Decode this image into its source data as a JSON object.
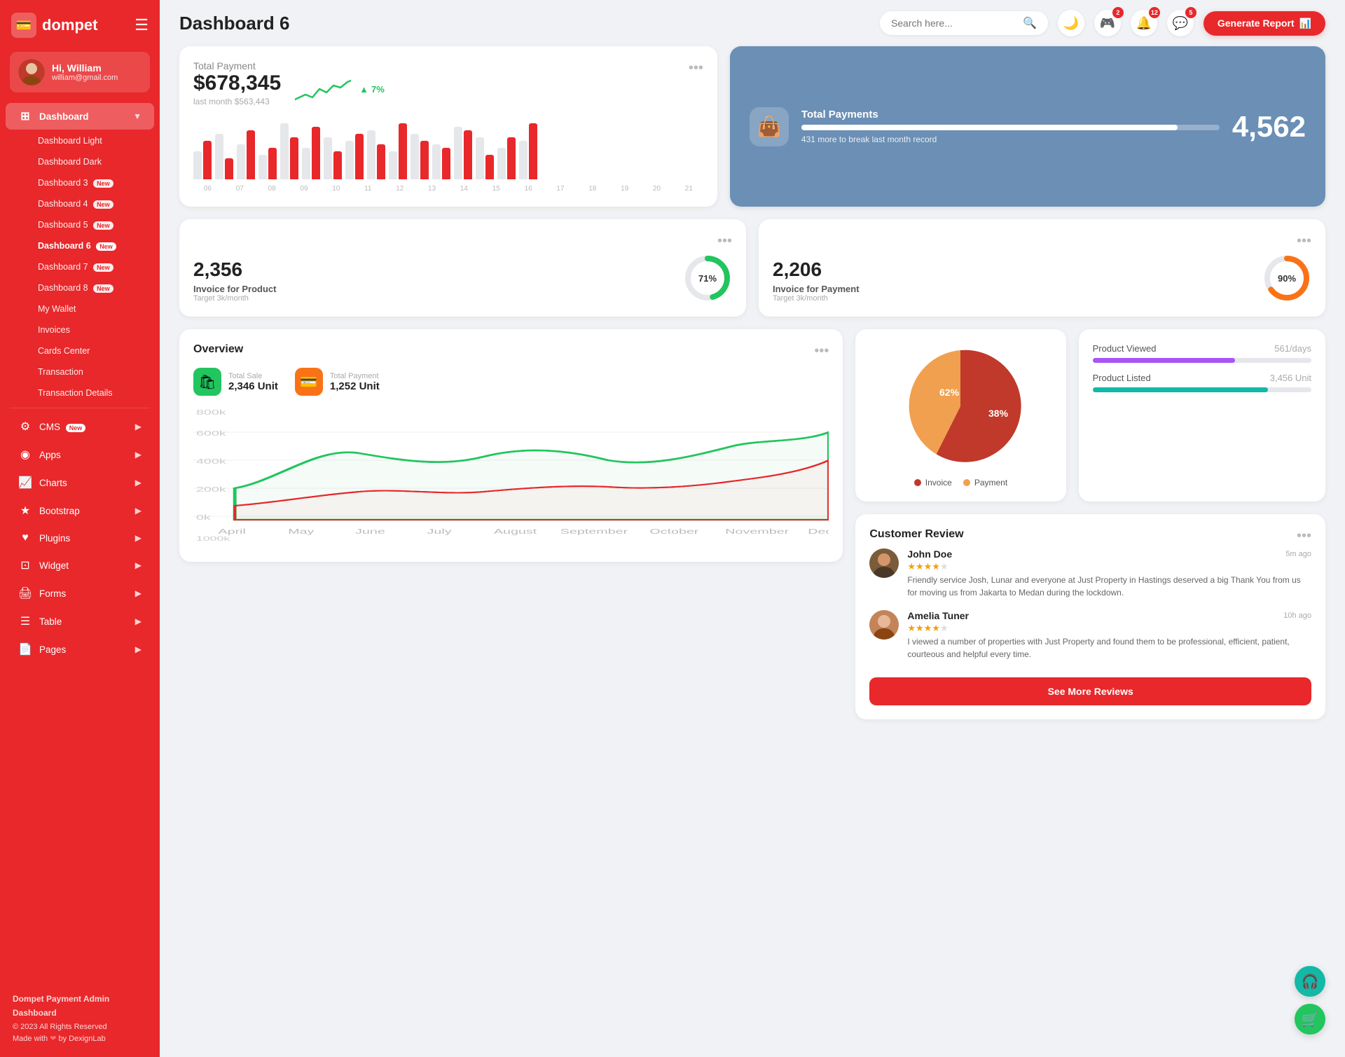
{
  "app": {
    "name": "dompet",
    "logo_icon": "💳"
  },
  "sidebar": {
    "user": {
      "name": "Hi, William",
      "email": "william@gmail.com"
    },
    "nav": [
      {
        "id": "dashboard",
        "label": "Dashboard",
        "icon": "⊞",
        "hasArrow": true,
        "active": true
      },
      {
        "id": "cms",
        "label": "CMS",
        "icon": "⚙",
        "hasArrow": true,
        "badge": "New"
      },
      {
        "id": "apps",
        "label": "Apps",
        "icon": "◉",
        "hasArrow": true
      },
      {
        "id": "charts",
        "label": "Charts",
        "icon": "📈",
        "hasArrow": true
      },
      {
        "id": "bootstrap",
        "label": "Bootstrap",
        "icon": "★",
        "hasArrow": true
      },
      {
        "id": "plugins",
        "label": "Plugins",
        "icon": "♥",
        "hasArrow": true
      },
      {
        "id": "widget",
        "label": "Widget",
        "icon": "⊡",
        "hasArrow": true
      },
      {
        "id": "forms",
        "label": "Forms",
        "icon": "🖨",
        "hasArrow": true
      },
      {
        "id": "table",
        "label": "Table",
        "icon": "☰",
        "hasArrow": true
      },
      {
        "id": "pages",
        "label": "Pages",
        "icon": "📄",
        "hasArrow": true
      }
    ],
    "sub_items": [
      {
        "id": "dashboard-light",
        "label": "Dashboard Light"
      },
      {
        "id": "dashboard-dark",
        "label": "Dashboard Dark"
      },
      {
        "id": "dashboard-3",
        "label": "Dashboard 3",
        "badge": "New"
      },
      {
        "id": "dashboard-4",
        "label": "Dashboard 4",
        "badge": "New"
      },
      {
        "id": "dashboard-5",
        "label": "Dashboard 5",
        "badge": "New"
      },
      {
        "id": "dashboard-6",
        "label": "Dashboard 6",
        "badge": "New",
        "active": true
      },
      {
        "id": "dashboard-7",
        "label": "Dashboard 7",
        "badge": "New"
      },
      {
        "id": "dashboard-8",
        "label": "Dashboard 8",
        "badge": "New"
      },
      {
        "id": "my-wallet",
        "label": "My Wallet"
      },
      {
        "id": "invoices",
        "label": "Invoices"
      },
      {
        "id": "cards-center",
        "label": "Cards Center"
      },
      {
        "id": "transaction",
        "label": "Transaction"
      },
      {
        "id": "transaction-details",
        "label": "Transaction Details"
      }
    ],
    "footer": {
      "title": "Dompet Payment Admin Dashboard",
      "copyright": "© 2023 All Rights Reserved",
      "made_by": "Made with ❤ by DexignLab"
    }
  },
  "topbar": {
    "title": "Dashboard 6",
    "search_placeholder": "Search here...",
    "badges": {
      "games": 2,
      "bell": 12,
      "chat": 5
    },
    "generate_btn": "Generate Report"
  },
  "total_payment": {
    "title": "Total Payment",
    "amount": "$678,345",
    "last_month_label": "last month $563,443",
    "trend_pct": "7%",
    "bars": [
      {
        "gray": 40,
        "red": 55
      },
      {
        "gray": 65,
        "red": 30
      },
      {
        "gray": 50,
        "red": 70
      },
      {
        "gray": 35,
        "red": 45
      },
      {
        "gray": 80,
        "red": 60
      },
      {
        "gray": 45,
        "red": 75
      },
      {
        "gray": 60,
        "red": 40
      },
      {
        "gray": 55,
        "red": 65
      },
      {
        "gray": 70,
        "red": 50
      },
      {
        "gray": 40,
        "red": 80
      },
      {
        "gray": 65,
        "red": 55
      },
      {
        "gray": 50,
        "red": 45
      },
      {
        "gray": 75,
        "red": 70
      },
      {
        "gray": 60,
        "red": 35
      },
      {
        "gray": 45,
        "red": 60
      }
    ],
    "labels": [
      "06",
      "07",
      "08",
      "09",
      "10",
      "11",
      "12",
      "13",
      "14",
      "15",
      "16",
      "17",
      "18",
      "19",
      "20",
      "21"
    ]
  },
  "total_payments_banner": {
    "title": "Total Payments",
    "sub": "431 more to break last month record",
    "count": "4,562",
    "bar_pct": 90
  },
  "invoice_product": {
    "title": "Invoice for Product",
    "amount": "2,356",
    "sub": "Target 3k/month",
    "percent": 71,
    "color": "#22c55e"
  },
  "invoice_payment": {
    "title": "Invoice for Payment",
    "amount": "2,206",
    "sub": "Target 3k/month",
    "percent": 90,
    "color": "#f97316"
  },
  "overview": {
    "title": "Overview",
    "total_sale": {
      "label": "Total Sale",
      "value": "2,346 Unit"
    },
    "total_payment": {
      "label": "Total Payment",
      "value": "1,252 Unit"
    },
    "months": [
      "April",
      "May",
      "June",
      "July",
      "August",
      "September",
      "October",
      "November",
      "Dec."
    ]
  },
  "pie_chart": {
    "invoice_pct": 62,
    "payment_pct": 38,
    "invoice_color": "#c0392b",
    "payment_color": "#f0a04e",
    "legend_invoice": "Invoice",
    "legend_payment": "Payment"
  },
  "product_stats": {
    "viewed": {
      "label": "Product Viewed",
      "value": "561/days",
      "color": "#a855f7",
      "pct": 65
    },
    "listed": {
      "label": "Product Listed",
      "value": "3,456 Unit",
      "color": "#14b8a6",
      "pct": 80
    }
  },
  "customer_review": {
    "title": "Customer Review",
    "reviews": [
      {
        "name": "John Doe",
        "time": "5m ago",
        "stars": 4,
        "text": "Friendly service Josh, Lunar and everyone at Just Property in Hastings deserved a big Thank You from us for moving us from Jakarta to Medan during the lockdown."
      },
      {
        "name": "Amelia Tuner",
        "time": "10h ago",
        "stars": 4,
        "text": "I viewed a number of properties with Just Property and found them to be professional, efficient, patient, courteous and helpful every time."
      }
    ],
    "see_more_btn": "See More Reviews"
  }
}
